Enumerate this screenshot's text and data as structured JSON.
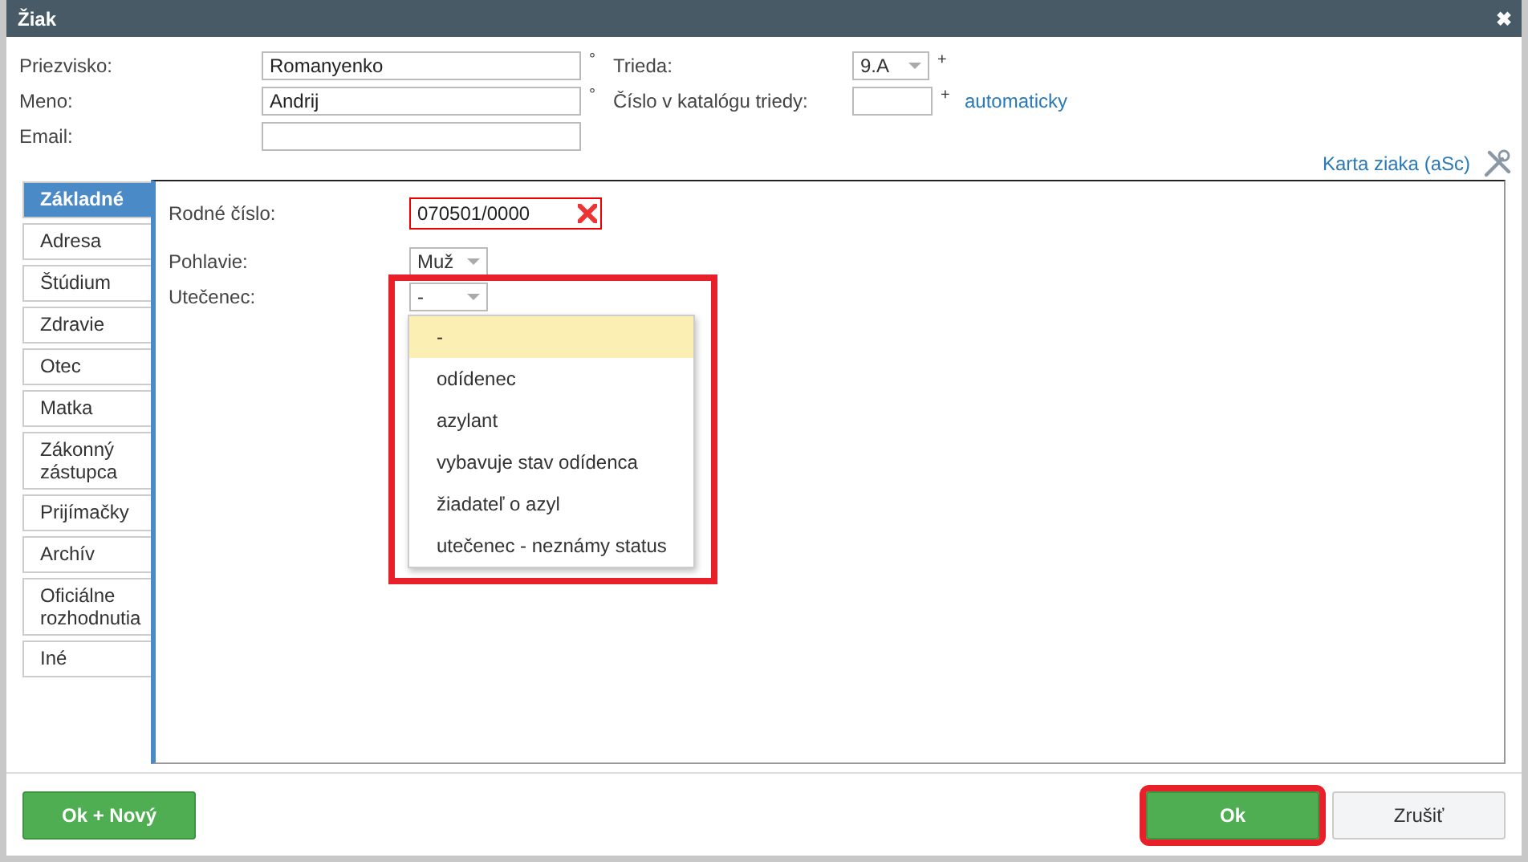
{
  "window": {
    "title": "Žiak",
    "close": "✖"
  },
  "fields": [
    {
      "label": "Priezvisko:",
      "value": "Romanyenko",
      "required_mark": "°"
    },
    {
      "label": "Meno:",
      "value": "Andrij",
      "required_mark": "°"
    },
    {
      "label": "Email:"
    }
  ],
  "class_fields": [
    {
      "label": "Trieda:",
      "kind": "select",
      "value": "9.A",
      "mark": "+"
    },
    {
      "label": "Číslo v katalógu triedy:",
      "kind": "input",
      "mark": "+",
      "link": "automaticky"
    }
  ],
  "card_link": "Karta ziaka (aSc)",
  "tabs": [
    {
      "label": "Základné",
      "selected": true
    },
    {
      "label": "Adresa",
      "selected": false
    },
    {
      "label": "Štúdium",
      "selected": false
    },
    {
      "label": "Zdravie",
      "selected": false
    },
    {
      "label": "Otec",
      "selected": false
    },
    {
      "label": "Matka",
      "selected": false
    },
    {
      "label": "Zákonný zástupca",
      "selected": false
    },
    {
      "label": "Prijímačky",
      "selected": false
    },
    {
      "label": "Archív",
      "selected": false
    },
    {
      "label": "Oficiálne rozhodnutia",
      "selected": false
    },
    {
      "label": "Iné",
      "selected": false
    }
  ],
  "birth_number": {
    "label": "Rodné číslo:",
    "value": "070501/0000",
    "invalid": true
  },
  "gender": {
    "label": "Pohlavie:",
    "value": "Muž"
  },
  "refugee": {
    "label": "Utečenec:",
    "value": "-",
    "expanded": true,
    "highlighted": true,
    "options": [
      {
        "label": "-",
        "selected": true
      },
      {
        "label": "odídenec",
        "selected": false
      },
      {
        "label": "azylant",
        "selected": false
      },
      {
        "label": "vybavuje stav odídenca",
        "selected": false
      },
      {
        "label": "žiadateľ o azyl",
        "selected": false
      },
      {
        "label": "utečenec - neznámy status",
        "selected": false
      }
    ]
  },
  "buttons": [
    {
      "label": "Ok + Nový",
      "kind": "primary",
      "highlighted": false
    },
    {
      "label": "Ok",
      "kind": "primary",
      "highlighted": true
    },
    {
      "label": "Zrušiť",
      "kind": "secondary",
      "highlighted": false
    }
  ]
}
